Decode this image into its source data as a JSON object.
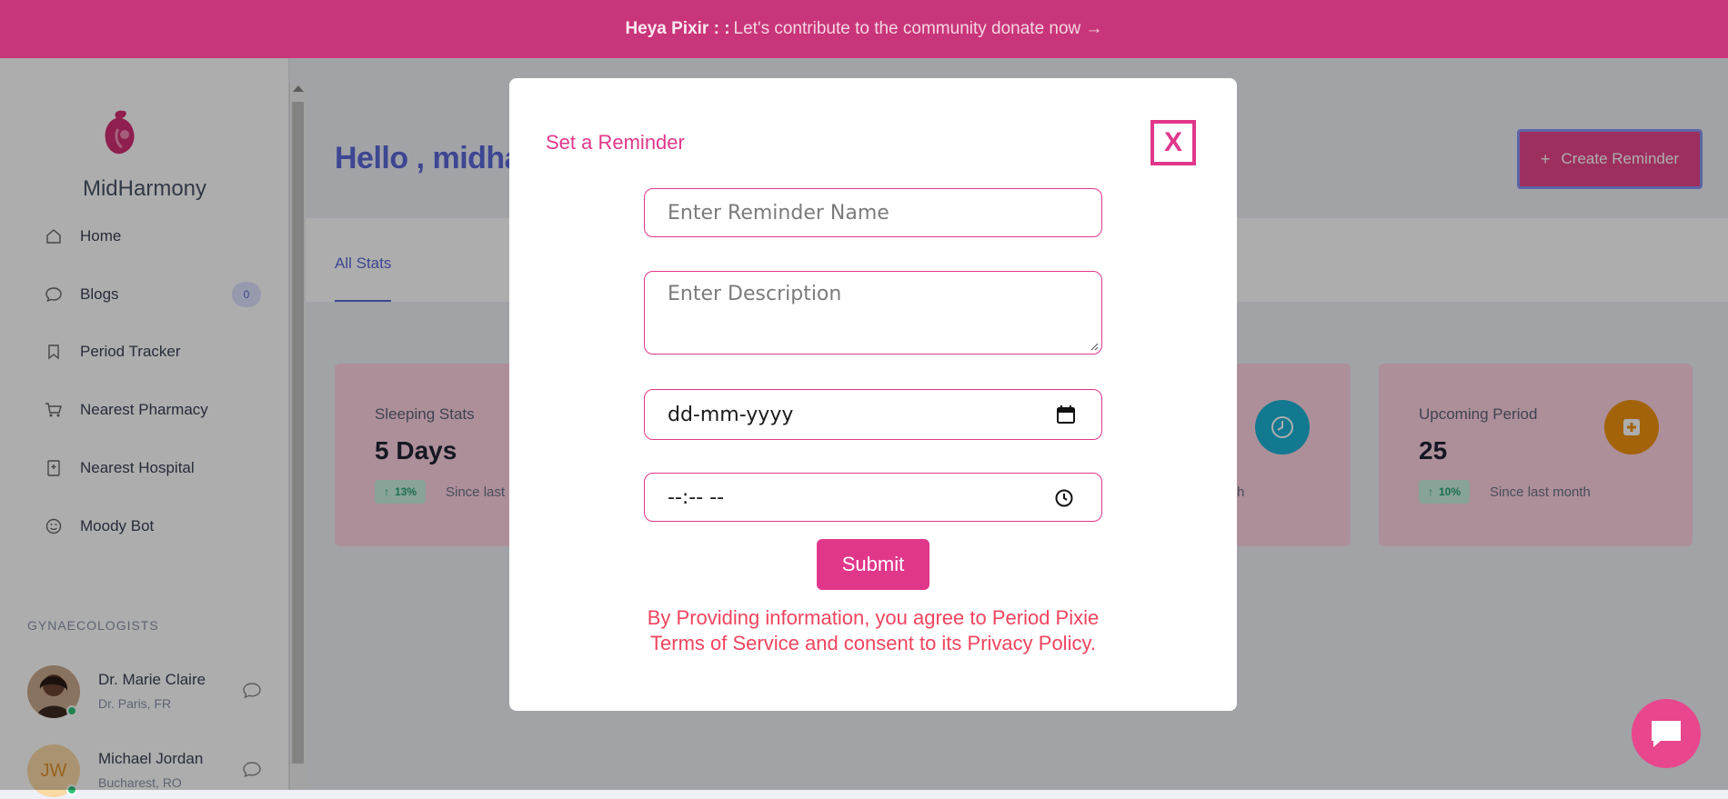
{
  "banner": {
    "bold": "Heya Pixir : :",
    "text": "Let's contribute to the community donate now →"
  },
  "sidebar": {
    "brand": "MidHarmony",
    "items": [
      {
        "label": "Home",
        "icon": "home-icon"
      },
      {
        "label": "Blogs",
        "icon": "chat-bubble-icon",
        "badge": "0"
      },
      {
        "label": "Period Tracker",
        "icon": "bookmark-icon"
      },
      {
        "label": "Nearest Pharmacy",
        "icon": "cart-icon"
      },
      {
        "label": "Nearest Hospital",
        "icon": "hospital-icon"
      },
      {
        "label": "Moody Bot",
        "icon": "smile-icon"
      }
    ],
    "section_title": "GYNAECOLOGISTS",
    "doctors": [
      {
        "name": "Dr. Marie Claire",
        "location": "Dr. Paris, FR",
        "status": "online"
      },
      {
        "name": "Michael Jordan",
        "location": "Bucharest, RO",
        "initials": "JW",
        "status": "online"
      }
    ]
  },
  "main": {
    "greeting": "Hello , midhar",
    "tab": "All Stats",
    "create_button": "Create Reminder",
    "cards": [
      {
        "title": "Sleeping Stats",
        "value": "5 Days",
        "change": "13%",
        "since": "Since last m"
      },
      {
        "since": "h",
        "icon": "clock-icon",
        "icon_color": "#1bb3d6"
      },
      {
        "title": "Upcoming Period",
        "value": "25",
        "change": "10%",
        "since": "Since last month",
        "icon": "plus-square-icon",
        "icon_color": "#f0930e"
      }
    ]
  },
  "modal": {
    "title": "Set a Reminder",
    "close_label": "X",
    "name_placeholder": "Enter Reminder Name",
    "description_placeholder": "Enter Description",
    "date_placeholder": "dd-mm-yyyy",
    "time_placeholder": "--:-- --",
    "submit_label": "Submit",
    "terms": "By Providing information, you agree to Period Pixie Terms of Service and consent to its Privacy Policy."
  },
  "colors": {
    "accent": "#e0378b",
    "banner": "#c9357a",
    "primary": "#5a67d8",
    "card_bg": "#ffd3e2",
    "terms_text": "#f0445e"
  }
}
